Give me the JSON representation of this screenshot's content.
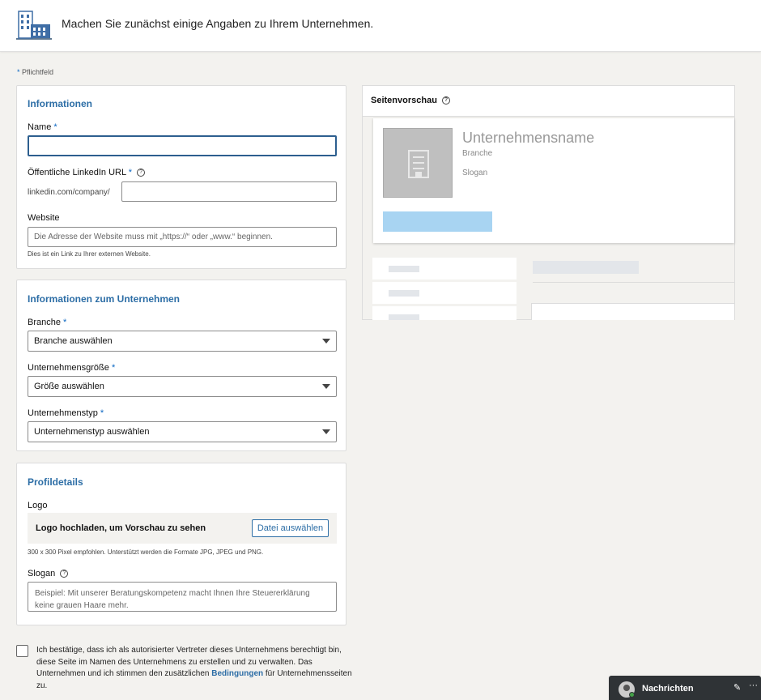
{
  "header": {
    "title": "Machen Sie zunächst einige Angaben zu Ihrem Unternehmen.",
    "icon": "building-icon"
  },
  "required_note": {
    "star": "*",
    "text": "Pflichtfeld"
  },
  "info": {
    "title": "Informationen",
    "name_label": "Name",
    "name_value": "",
    "url_label": "Öffentliche LinkedIn URL",
    "url_prefix": "linkedin.com/company/",
    "url_value": "",
    "website_label": "Website",
    "website_placeholder": "Die Adresse der Website muss mit „https://“ oder „www.“ beginnen.",
    "website_hint": "Dies ist ein Link zu Ihrer externen Website."
  },
  "company": {
    "title": "Informationen zum Unternehmen",
    "industry_label": "Branche",
    "industry_value": "Branche auswählen",
    "size_label": "Unternehmensgröße",
    "size_value": "Größe auswählen",
    "type_label": "Unternehmenstyp",
    "type_value": "Unternehmenstyp auswählen"
  },
  "profile": {
    "title": "Profildetails",
    "logo_label": "Logo",
    "logo_text": "Logo hochladen, um Vorschau zu sehen",
    "logo_button": "Datei auswählen",
    "logo_hint": "300 x 300 Pixel empfohlen. Unterstützt werden die Formate JPG, JPEG und PNG.",
    "slogan_label": "Slogan",
    "slogan_placeholder": "Beispiel: Mit unserer Beratungskompetenz macht Ihnen Ihre Steuererklärung keine grauen Haare mehr."
  },
  "consent": {
    "text": "Ich bestätige, dass ich als autorisierter Vertreter dieses Unternehmens berechtigt bin, diese Seite im Namen des Unternehmens zu erstellen und zu verwalten. Das Unternehmen und ich stimmen den zusätzlichen",
    "link": "Bedingungen",
    "tail": "für Unternehmensseiten zu."
  },
  "preview": {
    "title": "Seitenvorschau",
    "company_name": "Unternehmensname",
    "industry": "Branche",
    "slogan": "Slogan"
  },
  "messaging": {
    "label": "Nachrichten",
    "edit_glyph": "✎",
    "more_glyph": "···"
  },
  "help_glyph": "?",
  "colors": {
    "accent": "#2d6ea6",
    "link": "#0a66c2",
    "preview_button": "#a8d4f2"
  }
}
